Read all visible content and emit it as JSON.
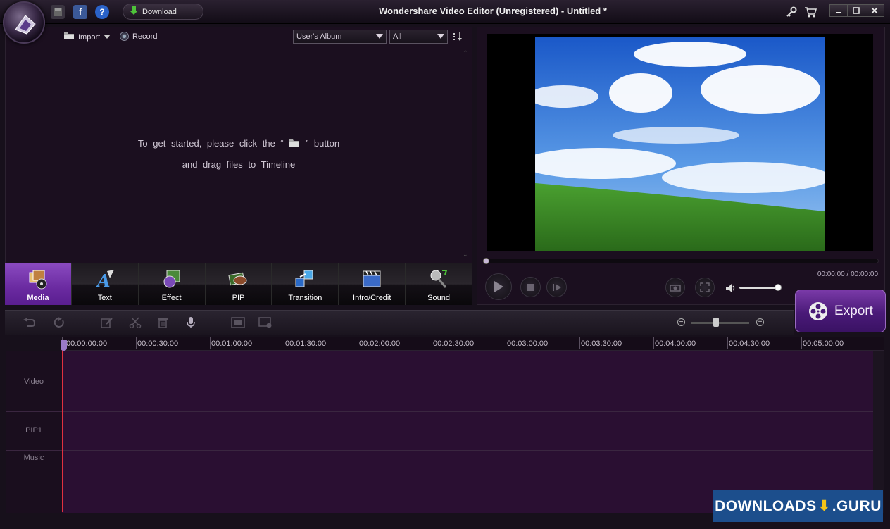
{
  "window": {
    "title": "Wondershare Video Editor (Unregistered) - Untitled *",
    "download_label": "Download",
    "facebook_glyph": "f",
    "help_glyph": "?",
    "icons": [
      "app-logo-icon",
      "save-icon",
      "facebook-icon",
      "help-icon",
      "download-arrow-icon",
      "key-icon",
      "cart-icon",
      "minimize-icon",
      "maximize-icon",
      "close-icon"
    ]
  },
  "media": {
    "import_label": "Import",
    "record_label": "Record",
    "album_select": "User's Album",
    "filter_select": "All",
    "hint_part1": "To get started, please click the “",
    "hint_part2": "” button",
    "hint_line2": "and drag files to Timeline"
  },
  "tabs": [
    {
      "label": "Media",
      "active": true
    },
    {
      "label": "Text",
      "active": false
    },
    {
      "label": "Effect",
      "active": false
    },
    {
      "label": "PIP",
      "active": false
    },
    {
      "label": "Transition",
      "active": false
    },
    {
      "label": "Intro/Credit",
      "active": false
    },
    {
      "label": "Sound",
      "active": false
    }
  ],
  "preview": {
    "time": "00:00:00 / 00:00:00",
    "progress": 0,
    "volume": 0.9
  },
  "export_label": "Export",
  "timeline": {
    "ruler": [
      "00:00:00:00",
      "00:00:30:00",
      "00:01:00:00",
      "00:01:30:00",
      "00:02:00:00",
      "00:02:30:00",
      "00:03:00:00",
      "00:03:30:00",
      "00:04:00:00",
      "00:04:30:00",
      "00:05:00:00"
    ],
    "tracks": [
      "Video",
      "PIP1",
      "Music"
    ],
    "zoom_minus": "−",
    "zoom_plus": "+"
  },
  "watermark": {
    "left": "DOWNLOADS",
    "right": ".GURU",
    "arrow": "⬇"
  },
  "colors": {
    "accent": "#6a2aa0",
    "background": "#17101b",
    "track": "#2a0f32",
    "playhead": "#e03040",
    "watermark_bg": "#1c4e8c"
  }
}
